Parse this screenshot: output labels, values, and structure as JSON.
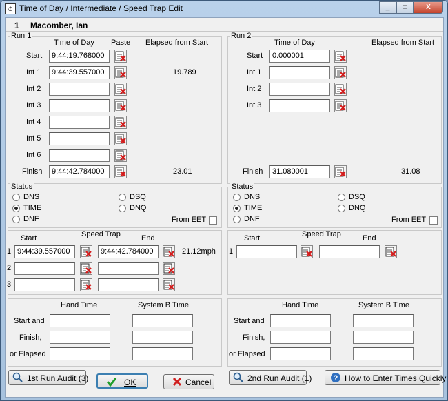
{
  "window": {
    "title": "Time of Day / Intermediate / Speed Trap Edit",
    "app_icon": "stopwatch-icon",
    "minimize": "_",
    "maximize": "□",
    "close": "X"
  },
  "racer": {
    "number": "1",
    "name": "Macomber, Ian"
  },
  "run1": {
    "legend": "Run 1",
    "col_tod": "Time of Day",
    "col_paste": "Paste",
    "col_elapsed": "Elapsed from Start",
    "rows": [
      {
        "label": "Start",
        "tod": "9:44:19.768000",
        "elapsed": ""
      },
      {
        "label": "Int 1",
        "tod": "9:44:39.557000",
        "elapsed": "19.789"
      },
      {
        "label": "Int 2",
        "tod": "",
        "elapsed": ""
      },
      {
        "label": "Int 3",
        "tod": "",
        "elapsed": ""
      },
      {
        "label": "Int 4",
        "tod": "",
        "elapsed": ""
      },
      {
        "label": "Int 5",
        "tod": "",
        "elapsed": ""
      },
      {
        "label": "Int 6",
        "tod": "",
        "elapsed": ""
      },
      {
        "label": "Finish",
        "tod": "9:44:42.784000",
        "elapsed": "23.01"
      }
    ],
    "status": {
      "legend": "Status",
      "dns": "DNS",
      "time": "TIME",
      "dnf": "DNF",
      "dsq": "DSQ",
      "dnq": "DNQ",
      "from_eet": "From EET",
      "selected": "TIME"
    },
    "speed": {
      "start": "Start",
      "title": "Speed Trap",
      "end": "End",
      "rows": [
        {
          "num": "1",
          "start": "9:44:39.557000",
          "end": "9:44:42.784000",
          "result": "21.12mph"
        },
        {
          "num": "2",
          "start": "",
          "end": "",
          "result": ""
        },
        {
          "num": "3",
          "start": "",
          "end": "",
          "result": ""
        }
      ]
    },
    "hand": {
      "hand_time": "Hand Time",
      "system_b": "System B Time",
      "start_and": "Start and",
      "finish": "Finish,",
      "or_elapsed": "or Elapsed"
    }
  },
  "run2": {
    "legend": "Run 2",
    "col_tod": "Time of Day",
    "col_elapsed": "Elapsed from Start",
    "rows": [
      {
        "label": "Start",
        "tod": "0.000001",
        "elapsed": ""
      },
      {
        "label": "Int 1",
        "tod": "",
        "elapsed": ""
      },
      {
        "label": "Int 2",
        "tod": "",
        "elapsed": ""
      },
      {
        "label": "Int 3",
        "tod": "",
        "elapsed": ""
      },
      {
        "label": "Finish",
        "tod": "31.080001",
        "elapsed": "31.08"
      }
    ],
    "status": {
      "legend": "Status",
      "dns": "DNS",
      "time": "TIME",
      "dnf": "DNF",
      "dsq": "DSQ",
      "dnq": "DNQ",
      "from_eet": "From EET",
      "selected": "TIME"
    },
    "speed": {
      "start": "Start",
      "title": "Speed Trap",
      "end": "End",
      "rows": [
        {
          "num": "1",
          "start": "",
          "end": "",
          "result": ""
        }
      ]
    },
    "hand": {
      "hand_time": "Hand Time",
      "system_b": "System B Time",
      "start_and": "Start and",
      "finish": "Finish,",
      "or_elapsed": "or Elapsed"
    }
  },
  "buttons": {
    "audit1": "1st Run Audit (3)",
    "ok": "OK",
    "cancel": "Cancel",
    "audit2": "2nd Run Audit (1)",
    "help": "How to Enter Times Quickly"
  },
  "colors": {
    "title_bar": "#b9d1ea",
    "panel": "#f0f0f0",
    "close": "#c3432c"
  }
}
